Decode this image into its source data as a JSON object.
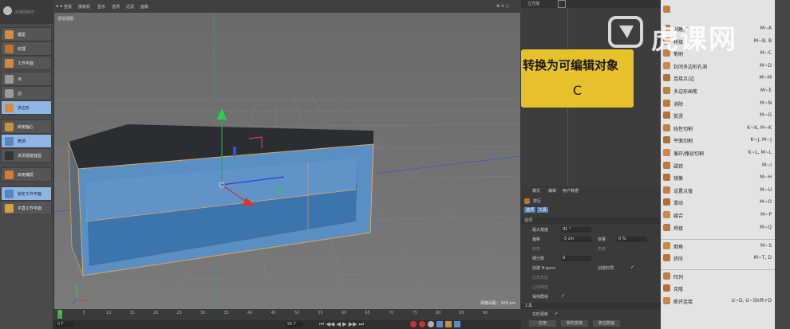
{
  "left_toolbar": {
    "logo_text": "虎课网制作",
    "tools": [
      {
        "label": "模型",
        "icon": "cube-model-icon",
        "color": "#d48b3a",
        "highlight": false
      },
      {
        "label": "纹理",
        "icon": "checker-texture-icon",
        "color": "#c07030",
        "highlight": false
      },
      {
        "label": "工作平面",
        "icon": "workplane-icon",
        "color": "#d08a40",
        "highlight": false
      },
      {
        "label": "点",
        "icon": "point-mode-icon",
        "color": "#999999",
        "highlight": false
      },
      {
        "label": "边",
        "icon": "edge-mode-icon",
        "color": "#999999",
        "highlight": false
      },
      {
        "label": "多边形",
        "icon": "polygon-mode-icon",
        "color": "#d48b3a",
        "highlight": true
      },
      {
        "label": "启用轴心",
        "icon": "axis-icon",
        "color": "#c89040",
        "highlight": false
      },
      {
        "label": "微调",
        "icon": "tweak-icon",
        "color": "#5a85c0",
        "highlight": true
      },
      {
        "label": "关闭视窗独显",
        "icon": "solo-off-icon",
        "color": "#333333",
        "highlight": false
      },
      {
        "label": "启用捕捉",
        "icon": "snap-icon",
        "color": "#d87a2a",
        "highlight": false
      },
      {
        "label": "锁定工作平面",
        "icon": "lock-workplane-icon",
        "color": "#5a85c0",
        "highlight": true
      },
      {
        "label": "平直工作平面",
        "icon": "planar-workplane-icon",
        "color": "#d8a040",
        "highlight": false
      }
    ]
  },
  "viewport": {
    "menu": [
      "查看",
      "摄像机",
      "显示",
      "选项",
      "过滤",
      "面板"
    ],
    "label": "透视视图",
    "grid_info": "网格间距：100 cm"
  },
  "timeline": {
    "ticks": [
      "0",
      "5",
      "10",
      "15",
      "20",
      "25",
      "30",
      "35",
      "40",
      "45",
      "50",
      "55",
      "60",
      "65",
      "70",
      "75",
      "80",
      "85",
      "90"
    ],
    "start_field": "0 F",
    "end_field": "90 F"
  },
  "object_manager": {
    "header_label": "立方体"
  },
  "attributes": {
    "tabs": [
      "模式",
      "编辑",
      "用户数据"
    ],
    "tool_name": "挤压",
    "subtabs": [
      "选项",
      "工具"
    ],
    "section_options": "选项",
    "rows": [
      {
        "label": "最大角度",
        "value": "91 °"
      },
      {
        "label": "偏移",
        "value": "-3 cm"
      },
      {
        "label": "变量",
        "value": "0 %"
      },
      {
        "label": "细分数",
        "value": "0"
      }
    ],
    "dim_labels": [
      "斜角",
      "角度",
      "创建 N-gons",
      "边角角度",
      "边缘精度",
      "保持群组"
    ],
    "create_caps": "创建封顶",
    "section_tool": "工具",
    "realtime": "实时更新",
    "buttons": [
      "应用",
      "新的变换",
      "复位数值"
    ]
  },
  "tooltip": {
    "title": "转换为可编辑对象",
    "key": "C"
  },
  "watermark": {
    "text": "虎课网"
  },
  "menu": {
    "items": [
      {
        "label": "",
        "shortcut": "",
        "icon": "menu-top-icon",
        "color": "#c08040"
      },
      {
        "label": "创建点",
        "shortcut": "M~A",
        "icon": "create-point-icon",
        "color": "#c07838"
      },
      {
        "label": "桥接",
        "shortcut": "M~B, B",
        "icon": "bridge-icon",
        "color": "#b87030"
      },
      {
        "label": "笔刷",
        "shortcut": "M~C",
        "icon": "brush-icon",
        "color": "#c08040"
      },
      {
        "label": "封闭多边形孔洞",
        "shortcut": "M~D",
        "icon": "close-hole-icon",
        "color": "#c88848"
      },
      {
        "label": "连接点/边",
        "shortcut": "M~M",
        "icon": "connect-icon",
        "color": "#b07030"
      },
      {
        "label": "多边形画笔",
        "shortcut": "M~E",
        "icon": "polygon-pen-icon",
        "color": "#c08040"
      },
      {
        "label": "消除",
        "shortcut": "M~N",
        "icon": "dissolve-icon",
        "color": "#c07838"
      },
      {
        "label": "熨烫",
        "shortcut": "M~G",
        "icon": "iron-icon",
        "color": "#b87030"
      },
      {
        "label": "线性切割",
        "shortcut": "K~K, M~K",
        "icon": "knife-icon",
        "color": "#c08040"
      },
      {
        "label": "平面切割",
        "shortcut": "K~J, M~J",
        "icon": "plane-cut-icon",
        "color": "#b07030"
      },
      {
        "label": "循环/路径切割",
        "shortcut": "K~L, M~L",
        "icon": "loop-cut-icon",
        "color": "#c88848"
      },
      {
        "label": "磁铁",
        "shortcut": "M~I",
        "icon": "magnet-icon",
        "color": "#c07838"
      },
      {
        "label": "镜像",
        "shortcut": "M~H",
        "icon": "mirror-icon",
        "color": "#b87030"
      },
      {
        "label": "设置点值",
        "shortcut": "M~U",
        "icon": "set-point-icon",
        "color": "#c08040"
      },
      {
        "label": "滑动",
        "shortcut": "M~O",
        "icon": "slide-icon",
        "color": "#b07030"
      },
      {
        "label": "缝合",
        "shortcut": "M~P",
        "icon": "stitch-icon",
        "color": "#c88848"
      },
      {
        "label": "焊接",
        "shortcut": "M~Q",
        "icon": "weld-icon",
        "color": "#c07838"
      },
      {
        "label": "倒角",
        "shortcut": "M~S",
        "icon": "bevel-icon",
        "color": "#d08838",
        "sep": true
      },
      {
        "label": "挤压",
        "shortcut": "M~T, D",
        "icon": "extrude-icon",
        "color": "#c07030"
      },
      {
        "label": "阵列",
        "shortcut": "",
        "icon": "array-icon",
        "color": "#c08040",
        "sep": true
      },
      {
        "label": "克隆",
        "shortcut": "",
        "icon": "clone-icon",
        "color": "#b87030"
      },
      {
        "label": "断开连接",
        "shortcut": "U~D, U~Shift+D",
        "icon": "disconnect-icon",
        "color": "#c88848"
      }
    ]
  }
}
